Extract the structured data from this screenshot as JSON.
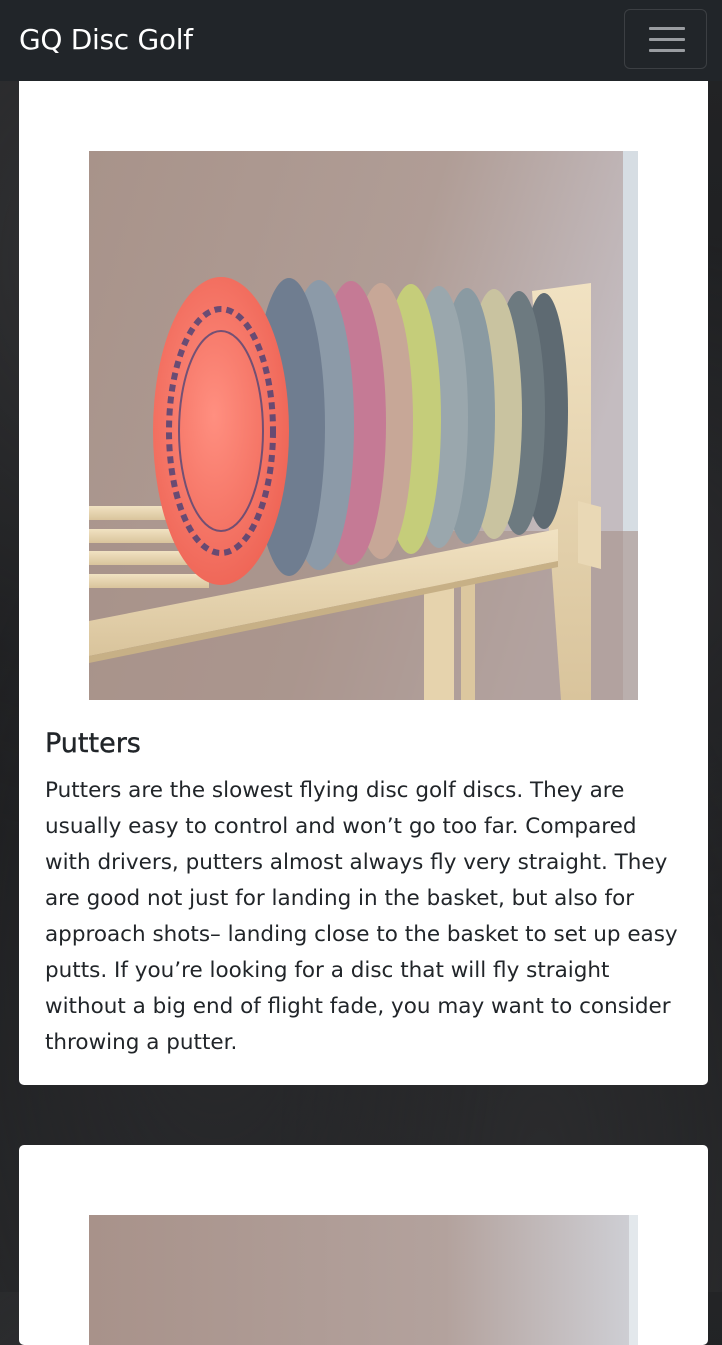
{
  "navbar": {
    "brand": "GQ Disc Golf",
    "toggler_icon": "hamburger-menu-icon"
  },
  "cards": [
    {
      "image_alt": "Stack of disc golf putters on a wooden rack",
      "title": "Putters",
      "text": "Putters are the slowest flying disc golf discs. They are usually easy to control and won’t go too far. Compared with drivers, putters almost always fly very straight. They are good not just for landing in the basket, but also for approach shots– landing close to the basket to set up easy putts. If you’re looking for a disc that will fly straight without a big end of flight fade, you may want to consider throwing a putter."
    },
    {
      "image_alt": "Disc golf discs"
    }
  ],
  "colors": {
    "navbar_bg": "#212529",
    "card_bg": "#ffffff",
    "text": "#212529"
  }
}
